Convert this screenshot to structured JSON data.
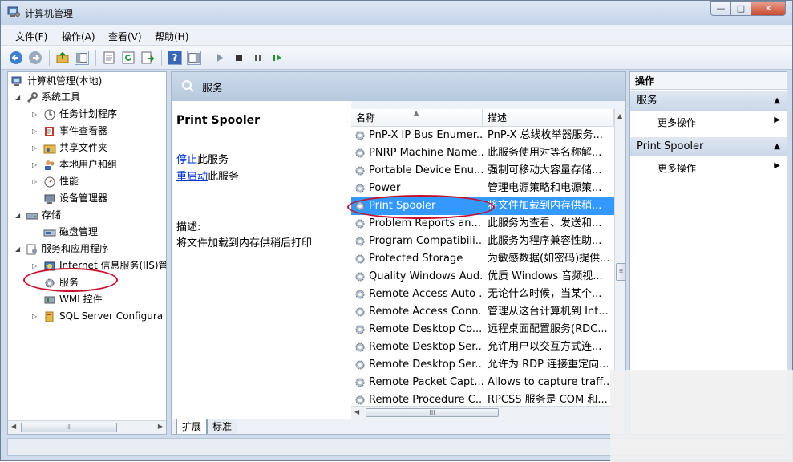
{
  "window": {
    "title": "计算机管理",
    "buttons": {
      "minimize": "—",
      "maximize": "□",
      "close": "✕"
    }
  },
  "menu": [
    "文件(F)",
    "操作(A)",
    "查看(V)",
    "帮助(H)"
  ],
  "toolbar": {
    "help": "?"
  },
  "tree": {
    "root": "计算机管理(本地)",
    "system_tools": "系统工具",
    "task_scheduler": "任务计划程序",
    "event_viewer": "事件查看器",
    "shared_folders": "共享文件夹",
    "local_users": "本地用户和组",
    "performance": "性能",
    "device_manager": "设备管理器",
    "storage": "存储",
    "disk_management": "磁盘管理",
    "services_apps": "服务和应用程序",
    "iis": "Internet 信息服务(IIS)管",
    "services": "服务",
    "wmi": "WMI 控件",
    "sql_server": "SQL Server Configura",
    "hscroll_thumb": "III"
  },
  "middle": {
    "header": "服务",
    "selected_service": "Print Spooler",
    "stop_link": "停止",
    "stop_suffix": "此服务",
    "restart_link": "重启动",
    "restart_suffix": "此服务",
    "desc_label": "描述:",
    "desc_text": "将文件加载到内存供稍后打印",
    "columns": {
      "name": "名称",
      "desc": "描述"
    },
    "rows": [
      {
        "name": "PnP-X IP Bus Enumer...",
        "desc": "PnP-X 总线枚举器服务..."
      },
      {
        "name": "PNRP Machine Name...",
        "desc": "此服务使用对等名称解..."
      },
      {
        "name": "Portable Device Enu...",
        "desc": "强制可移动大容量存储..."
      },
      {
        "name": "Power",
        "desc": "管理电源策略和电源策..."
      },
      {
        "name": "Print Spooler",
        "desc": "将文件加载到内存供稍..."
      },
      {
        "name": "Problem Reports an...",
        "desc": "此服务为查看、发送和..."
      },
      {
        "name": "Program Compatibili...",
        "desc": "此服务为程序兼容性助..."
      },
      {
        "name": "Protected Storage",
        "desc": "为敏感数据(如密码)提供..."
      },
      {
        "name": "Quality Windows Aud...",
        "desc": "优质 Windows 音频视..."
      },
      {
        "name": "Remote Access Auto ...",
        "desc": "无论什么时候，当某个..."
      },
      {
        "name": "Remote Access Conn...",
        "desc": "管理从这台计算机到 Int..."
      },
      {
        "name": "Remote Desktop Co...",
        "desc": "远程桌面配置服务(RDC..."
      },
      {
        "name": "Remote Desktop Ser...",
        "desc": "允许用户以交互方式连..."
      },
      {
        "name": "Remote Desktop Ser...",
        "desc": "允许为 RDP 连接重定向..."
      },
      {
        "name": "Remote Packet Capt...",
        "desc": "Allows to capture traff..."
      },
      {
        "name": "Remote Procedure C...",
        "desc": "RPCSS 服务是 COM 和..."
      }
    ],
    "hscroll_thumb": "III",
    "vscroll_thumb": "≡",
    "tabs": [
      "扩展",
      "标准"
    ]
  },
  "actions": {
    "title": "操作",
    "section1": "服务",
    "more1": "更多操作",
    "section2": "Print Spooler",
    "more2": "更多操作"
  },
  "colors": {
    "selection": "#3399ff",
    "annotation": "#c8102e",
    "link": "#0033cc"
  }
}
